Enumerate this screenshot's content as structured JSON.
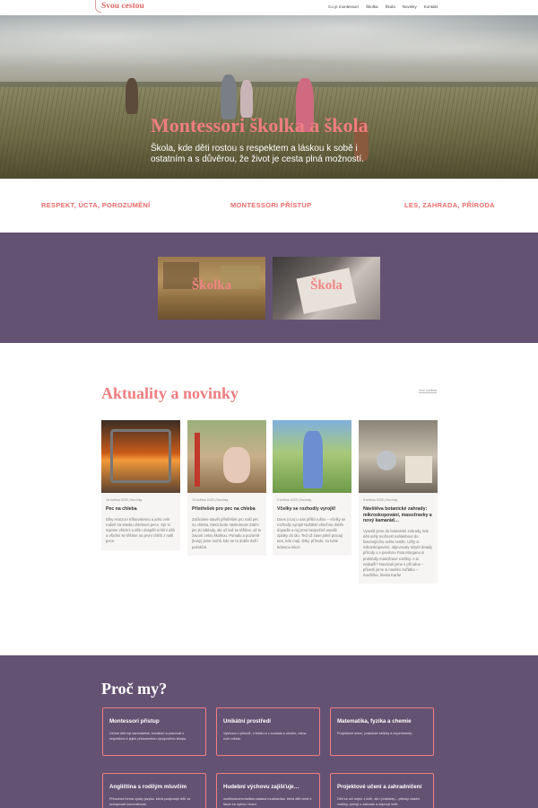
{
  "header": {
    "logo_text": "Svou cestou",
    "nav": [
      "Co je montessori",
      "Školka",
      "Škola",
      "Novinky",
      "Kontakt"
    ]
  },
  "hero": {
    "title": "Montessori školka a škola",
    "subtitle": "Škola, kde děti rostou s respektem a láskou k sobě i ostatním a s důvěrou, že život je cesta plná možností."
  },
  "values": [
    "RESPEKT, ÚCTA, POROZUMĚNÍ",
    "MONTESSORI PŘÍSTUP",
    "LES, ZAHRADA, PŘÍRODA"
  ],
  "sections": {
    "cards": [
      {
        "label": "Školka"
      },
      {
        "label": "Škola"
      }
    ]
  },
  "news": {
    "title": "Aktuality a novinky",
    "more_link": "Více novinek",
    "posts": [
      {
        "meta": "16 května 2025 | Novinky",
        "title": "Pec na chleba",
        "excerpt": "Díky Honzovi Křikovskému a jeho celé rodině za stavbu chlebové pece. Sýr si sujeme všichni a děti i dospělí si hlíni užili a všichni se těšíme na první chléb z naší pece."
      },
      {
        "meta": "13 května 2025 | Novinky",
        "title": "Přístřešek pro pec na chleba",
        "excerpt": "Začínáme stavět přístřešek pro naši pec na chleba, která bude následovat! Zatím jen jsi základy, ale už teď se těšíme, až to zavoní celou školkou. Pomalu a pozorně (kusy) jsme mohli, kde se to dobře daří i pokráčet."
      },
      {
        "meta": "9 května 2025 | Novinky",
        "title": "Včelky se rozhodly vyrojit!",
        "excerpt": "Dnes (cca) u nás přišlo rušno – včelky se rozhodly vyrojit! Naštěstí všechno dobře dopadlo a roj jsme bezpečně usadili zpátky do úlu. Teď už zase pilně pracují tam, kde mají. Díky, přírodo, za tuhle krásnou lekci!"
      },
      {
        "meta": "8 května 2025 | Novinky",
        "title": "Návštěva botanické zahrady: mikroskopování, masožravky a nový kamarád…",
        "excerpt": "Vyrazili jsme do botanické zahrady, kde děti měly možnost nahlédnout do fascinujícího světa rostlin. Užily si mikroskopování, objevovaly skryté detaily přírody a v pavilonu Fata Morgana si prohlédly masožravé rostliny. A to nejlepší? Navázali jsme s přírodou – přivezli jsme si novéko zvířátko – mazlíčka, šneka Karla!"
      }
    ]
  },
  "why": {
    "title": "Proč my?",
    "boxes": [
      {
        "title": "Montessori přístup",
        "desc": "Učíme děti být samostatné, kreativní a pracovat s respektem k jejich přirozenému vývojovému tempu."
      },
      {
        "title": "Unikátní prostředí",
        "desc": "Výchova v přírodě, v lesíku a v souladu s okolím, mimo ruch města."
      },
      {
        "title": "Matematika, fyzika a chemie",
        "desc": "Projektové učení, praktické aktivity a experimenty."
      },
      {
        "title": "Angličtina s rodilým mluvčím",
        "desc": "Přirozená forma výuky jazyka, která podporuje děti ve schopnosti komunikovat."
      },
      {
        "title": "Hudební výchovu zajišťuje…",
        "desc": "multiinstrumentalista nadaná muzikantka, která děti vede k lásce ke zpěvu i hraní."
      },
      {
        "title": "Projektové učení a zahradničení",
        "desc": "Děti se učí nejen z knih, ale i prakticky – pěstují vlastní rostliny, pečují o zahradu a objevují svět."
      }
    ]
  },
  "colors": {
    "accent": "#ef7d80",
    "purple": "#645273",
    "white": "#ffffff"
  }
}
